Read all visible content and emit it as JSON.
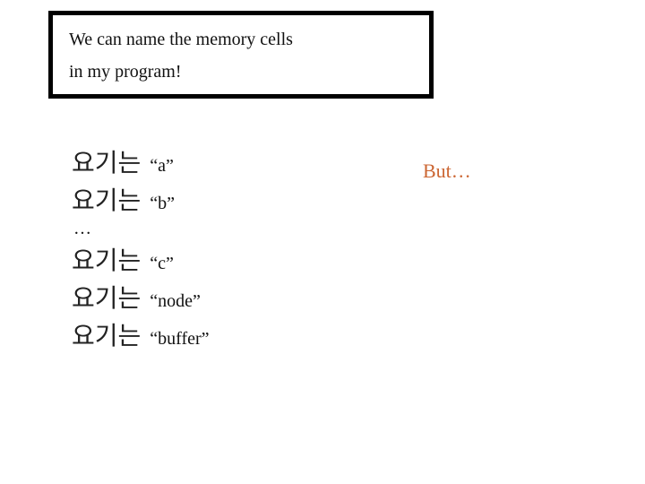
{
  "titleBox": {
    "line1": "We can name the memory cells",
    "line2": "in my program!"
  },
  "naming": {
    "prefix": "요기는",
    "rows1": [
      {
        "label": "“a”"
      },
      {
        "label": "“b”"
      }
    ],
    "ellipsis": "…",
    "rows2": [
      {
        "label": "“c”"
      },
      {
        "label": "“node”"
      },
      {
        "label": "“buffer”"
      }
    ]
  },
  "aside": {
    "but": "But…"
  }
}
